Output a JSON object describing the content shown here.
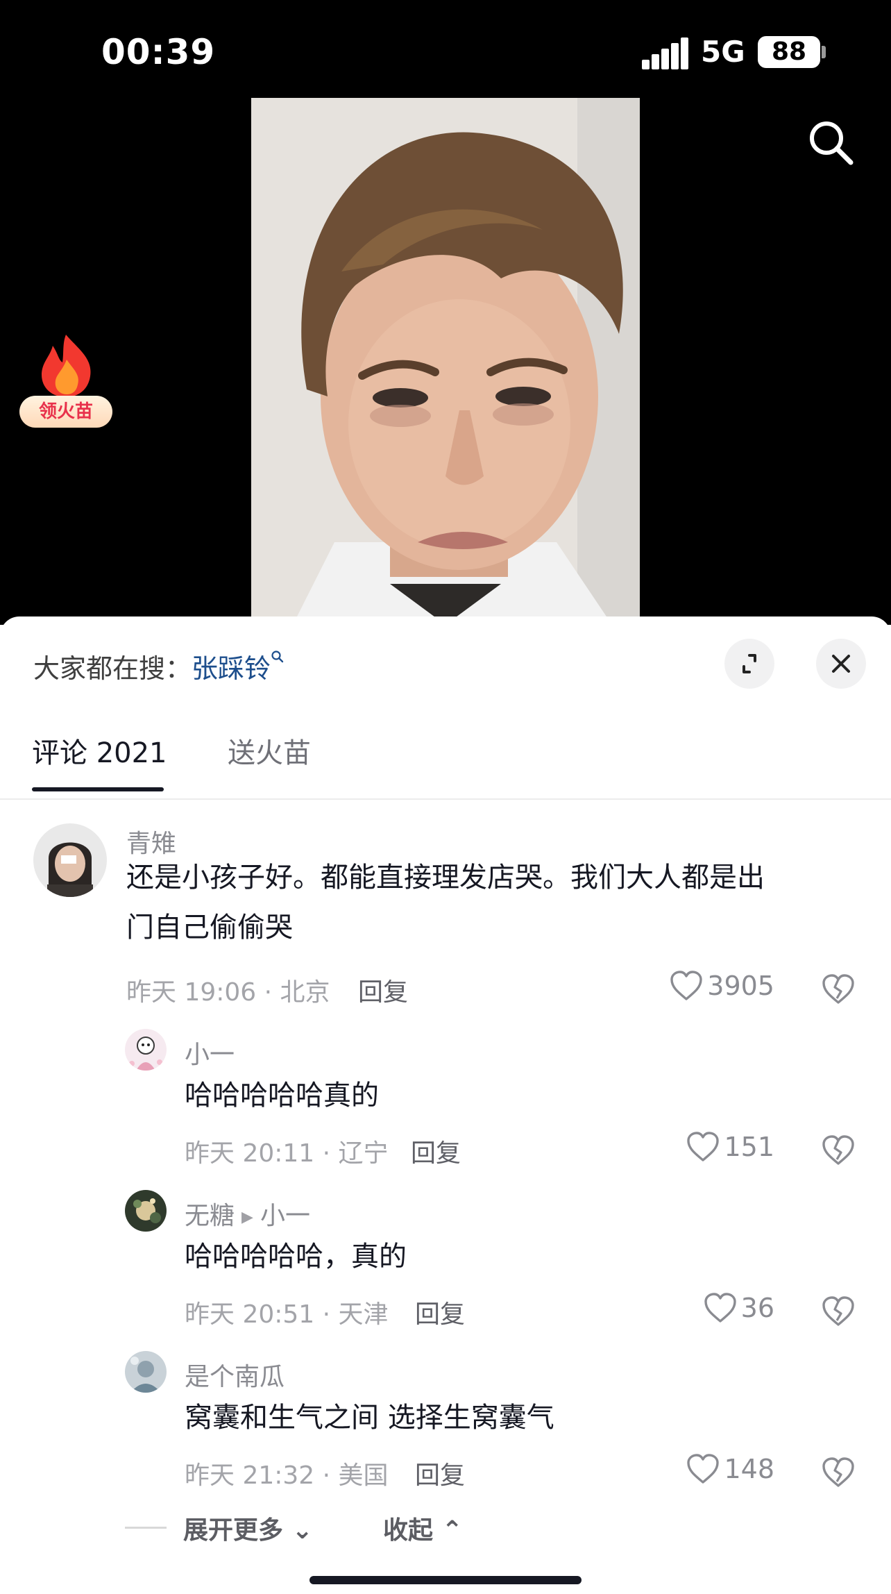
{
  "status_bar": {
    "time": "00:39",
    "network": "5G",
    "battery": "88"
  },
  "video": {
    "fire_badge_label": "领火苗"
  },
  "sheet": {
    "hot_search_prefix": "大家都在搜：",
    "hot_search_keyword": "张踩铃",
    "tabs": [
      {
        "label": "评论 2021"
      },
      {
        "label": "送火苗"
      }
    ],
    "comments": [
      {
        "user": "青雉",
        "text_line1": "还是小孩子好。都能直接理发店哭。我们大人都是出",
        "text_line2": "门自己偷偷哭",
        "meta": "昨天 19:06 · 北京",
        "reply_label": "回复",
        "likes": "3905"
      },
      {
        "user": "小一",
        "text": "哈哈哈哈哈真的",
        "meta": "昨天 20:11 · 辽宁",
        "reply_label": "回复",
        "likes": "151"
      },
      {
        "user": "无糖",
        "reply_to": "小一",
        "text": "哈哈哈哈哈，真的",
        "meta": "昨天 20:51 · 天津",
        "reply_label": "回复",
        "likes": "36"
      },
      {
        "user": "是个南瓜",
        "text": "窝囊和生气之间 选择生窝囊气",
        "meta": "昨天 21:32 · 美国",
        "reply_label": "回复",
        "likes": "148"
      }
    ],
    "expand_more": "展开更多",
    "collapse": "收起"
  },
  "icons": {
    "search": "search-icon",
    "expand": "expand-icon",
    "close": "close-icon",
    "like": "heart-icon",
    "dislike": "broken-heart-icon",
    "fire": "flame-icon"
  },
  "colors": {
    "keyword_blue": "#1d4e8c",
    "fire_red": "#e8314b"
  }
}
